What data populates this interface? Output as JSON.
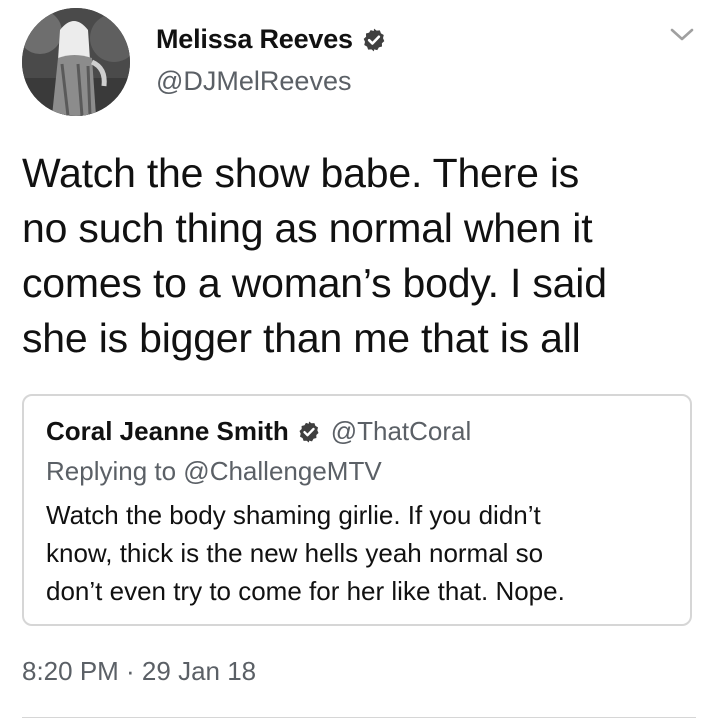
{
  "author": {
    "display_name": "Melissa Reeves",
    "handle": "@DJMelReeves",
    "verified": true,
    "avatar_icon": "profile-photo"
  },
  "menu_icon": "chevron-down-icon",
  "tweet": {
    "text_lines": [
      "Watch the show babe. There is",
      "no such thing as normal when it",
      "comes to a woman’s body. I said",
      "she is bigger than me that is all"
    ]
  },
  "quoted_tweet": {
    "display_name": "Coral Jeanne Smith",
    "handle": "@ThatCoral",
    "verified": true,
    "replying_to": "Replying to @ChallengeMTV",
    "text_lines": [
      "Watch the body shaming girlie. If you didn’t",
      "know, thick is the new hells yeah normal so",
      "don’t even try to come for her like that. Nope."
    ]
  },
  "timestamp": "8:20 PM · 29 Jan 18",
  "colors": {
    "text": "#111111",
    "secondary_text": "#5b6066",
    "border": "#d6d6d6",
    "verified_badge": "#3f3f3f"
  }
}
